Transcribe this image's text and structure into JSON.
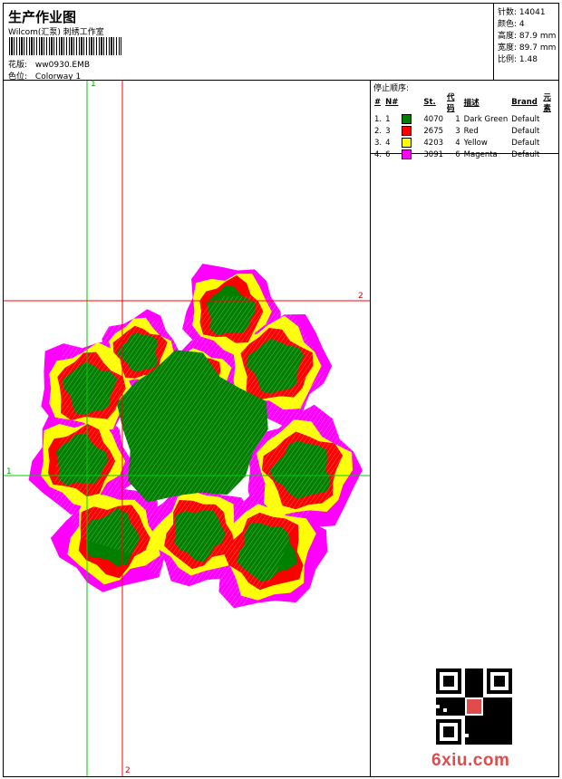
{
  "header": {
    "title": "生产作业图",
    "subtitle": "Wilcom(汇泵) 刺绣工作室",
    "design_label": "花版:",
    "design_value": "ww0930.EMB",
    "colorway_label": "色位:",
    "colorway_value": "Colorway 1"
  },
  "stats": [
    {
      "label": "针数:",
      "value": "14041"
    },
    {
      "label": "颜色:",
      "value": "4"
    },
    {
      "label": "高度:",
      "value": "87.9 mm"
    },
    {
      "label": "宽度:",
      "value": "89.7 mm"
    },
    {
      "label": "比例:",
      "value": "1.48"
    }
  ],
  "stop_sequence": {
    "title": "停止顺序:",
    "columns": [
      "#",
      "N#",
      "St.",
      "代码",
      "描述",
      "Brand",
      "元素"
    ],
    "rows": [
      {
        "seq": "1.",
        "n": "1",
        "st": "4070",
        "code": "1",
        "desc": "Dark Green",
        "brand": "Default",
        "color": "#008000"
      },
      {
        "seq": "2.",
        "n": "3",
        "st": "2675",
        "code": "3",
        "desc": "Red",
        "brand": "Default",
        "color": "#ff0000"
      },
      {
        "seq": "3.",
        "n": "4",
        "st": "4203",
        "code": "4",
        "desc": "Yellow",
        "brand": "Default",
        "color": "#ffff00"
      },
      {
        "seq": "4.",
        "n": "6",
        "st": "3091",
        "code": "6",
        "desc": "Magenta",
        "brand": "Default",
        "color": "#ff00ff"
      }
    ]
  },
  "guides": {
    "v1_label": "1",
    "v2_label": "2",
    "h1_label": "1",
    "h2_label": "2",
    "v1_bottom_label": "",
    "v2_bottom_label": "2",
    "h1_color": "#00cc00",
    "h2_color": "#ff0000",
    "v1_color": "#00cc00",
    "v2_color": "#ff0000"
  },
  "design_preview": {
    "icon": "embroidery-flower-icon",
    "palette": [
      "#ff00ff",
      "#ffff00",
      "#ff0000",
      "#008000"
    ]
  },
  "watermark": {
    "text": "6xiu.com",
    "icon": "qr-code-icon",
    "color": "#e14b4b"
  }
}
